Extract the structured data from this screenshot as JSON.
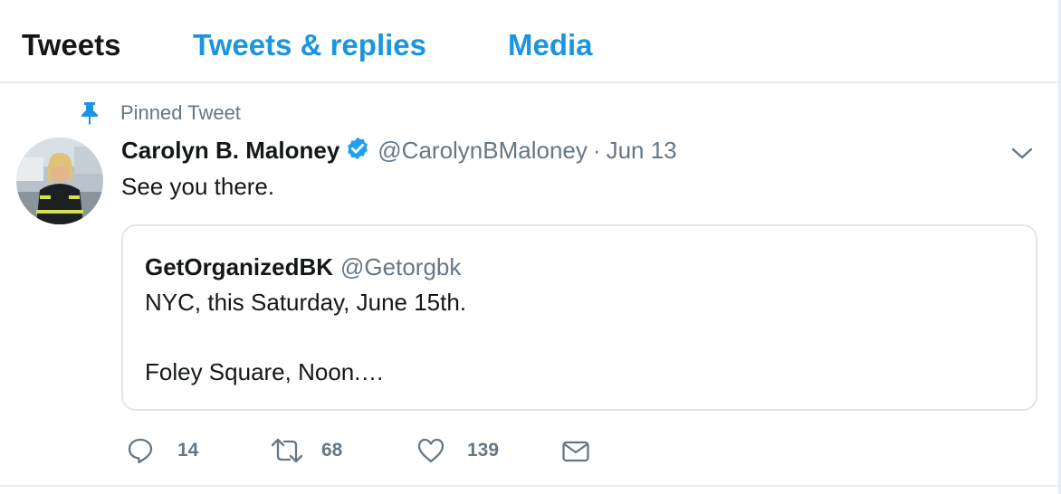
{
  "tabs": [
    {
      "label": "Tweets",
      "active": true
    },
    {
      "label": "Tweets & replies",
      "active": false
    },
    {
      "label": "Media",
      "active": false
    }
  ],
  "pinned": {
    "label": "Pinned Tweet",
    "icon": "pin-icon"
  },
  "tweet": {
    "name": "Carolyn B. Maloney",
    "verified": true,
    "handle": "@CarolynBMaloney",
    "separator": "·",
    "date": "Jun 13",
    "text": "See you there.",
    "quoted": {
      "name": "GetOrganizedBK",
      "handle": "@Getorgbk",
      "line1": "NYC, this Saturday, June 15th.",
      "line2": "Foley Square, Noon.…"
    },
    "actions": {
      "replies": "14",
      "retweets": "68",
      "likes": "139"
    }
  },
  "colors": {
    "accent": "#1b95e0",
    "verified": "#1da1f2",
    "secondary_text": "#657786",
    "border": "#e6ecf0"
  }
}
